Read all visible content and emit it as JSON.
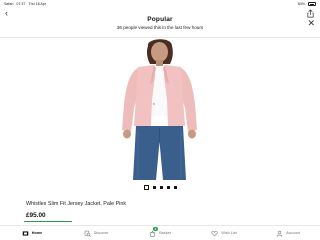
{
  "statusbar": {
    "carrier": "Safari",
    "time": "07:37",
    "date": "Thu 18 Apr",
    "battery": "84%"
  },
  "banner": {
    "title": "Popular",
    "subtitle": "36 people viewed this in the last few hours"
  },
  "product": {
    "name": "Whistles Slim Fit Jersey Jacket, Pale Pink",
    "price": "£95.00",
    "image_count": 5,
    "active_image": 1
  },
  "tabbar": {
    "items": [
      {
        "label": "Home",
        "icon": "home-icon",
        "active": true
      },
      {
        "label": "Discover",
        "icon": "discover-icon",
        "active": false
      },
      {
        "label": "Basket",
        "icon": "basket-icon",
        "active": false,
        "badge": "2"
      },
      {
        "label": "Wish List",
        "icon": "heart-icon",
        "active": false
      },
      {
        "label": "Account",
        "icon": "account-icon",
        "active": false
      }
    ]
  },
  "colors": {
    "accent_green": "#2aa046",
    "jacket_pink": "#efbcbc",
    "jeans_blue": "#3a5f8c"
  }
}
